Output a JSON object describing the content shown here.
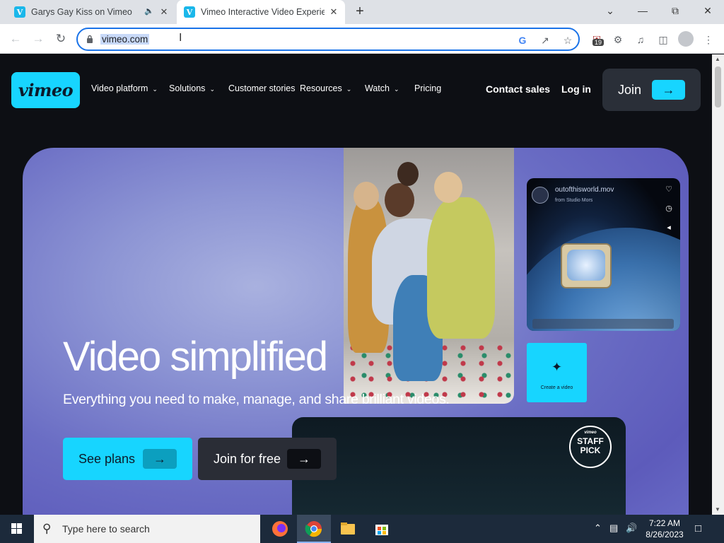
{
  "browser": {
    "tabs": [
      {
        "title": "Garys Gay Kiss on Vimeo",
        "favicon": "V",
        "audio": true
      },
      {
        "title": "Vimeo Interactive Video Experien",
        "favicon": "V",
        "active": true
      }
    ],
    "url": "vimeo.com",
    "extension_badge": "19"
  },
  "site": {
    "logo": "vimeo",
    "nav": [
      "Video platform",
      "Solutions",
      "Customer stories",
      "Resources",
      "Watch",
      "Pricing"
    ],
    "contact_sales": "Contact sales",
    "login": "Log in",
    "join": "Join",
    "accent_color": "#17d5ff"
  },
  "hero": {
    "headline": "Video simplified",
    "subheadline": "Everything you need to make, manage, and share brilliant videos.",
    "see_plans": "See plans",
    "join_free": "Join for free",
    "player_card": {
      "file_name": "outofthisworld.mov",
      "from": "from Studio Mors"
    },
    "create_card": {
      "label": "Create a video"
    },
    "staff_pick": {
      "brand": "vimeo",
      "line1": "STAFF",
      "line2": "PICK"
    }
  },
  "taskbar": {
    "search_placeholder": "Type here to search",
    "time": "7:22 AM",
    "date": "8/26/2023"
  }
}
